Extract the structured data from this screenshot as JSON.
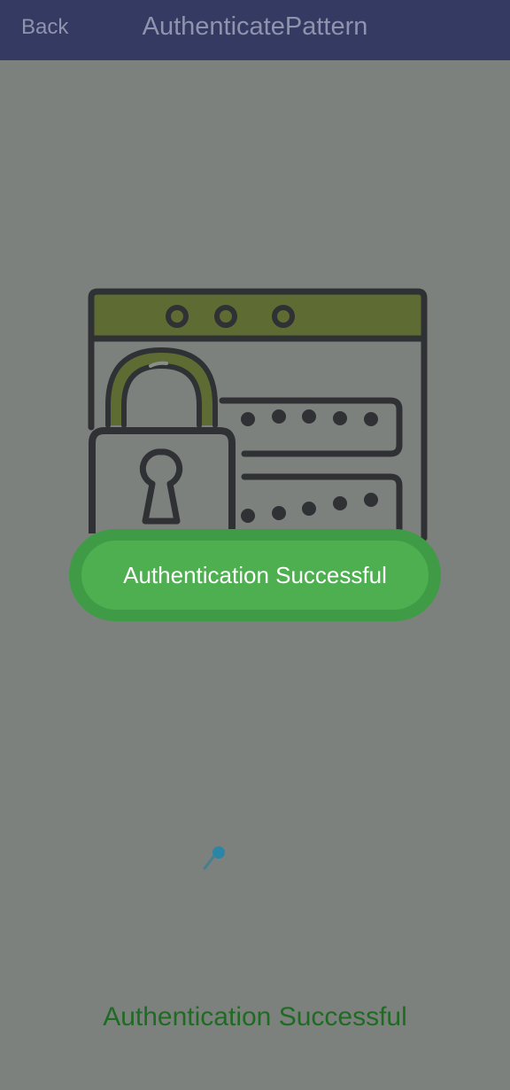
{
  "header": {
    "back_label": "Back",
    "title": "AuthenticatePattern"
  },
  "toast": {
    "message": "Authentication Successful"
  },
  "status": {
    "message": "Authentication Successful"
  },
  "icons": {
    "illustration": "browser-lock-password-illustration",
    "loader": "loading-spinner-icon"
  },
  "colors": {
    "header_bg": "#353a63",
    "header_text": "#8f93ad",
    "page_bg": "#7c817d",
    "toast_outer": "#3f9b46",
    "toast_inner": "#4daf4f",
    "status_text": "#1f6b23"
  }
}
